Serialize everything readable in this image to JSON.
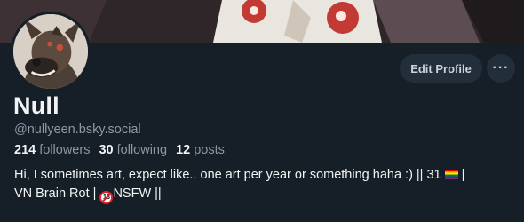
{
  "profile": {
    "display_name": "Null",
    "handle": "@nullyeen.bsky.social",
    "stats": {
      "followers_count": "214",
      "followers_label": "followers",
      "following_count": "30",
      "following_label": "following",
      "posts_count": "12",
      "posts_label": "posts"
    },
    "bio": {
      "part1": "Hi, I sometimes art, expect like.. one art per year or something haha :) || 31 ",
      "part2": " |",
      "part3": "VN Brain Rot | ",
      "part4": "NSFW ||"
    }
  },
  "actions": {
    "edit_profile_label": "Edit Profile",
    "more_label": "···"
  },
  "icons": {
    "avatar": "hyena-avatar",
    "flag": "rainbow-flag-icon",
    "nsfw": "no-18-icon"
  },
  "colors": {
    "background": "#161e27",
    "button_bg": "#232e3b",
    "muted_text": "#8b99a6"
  }
}
